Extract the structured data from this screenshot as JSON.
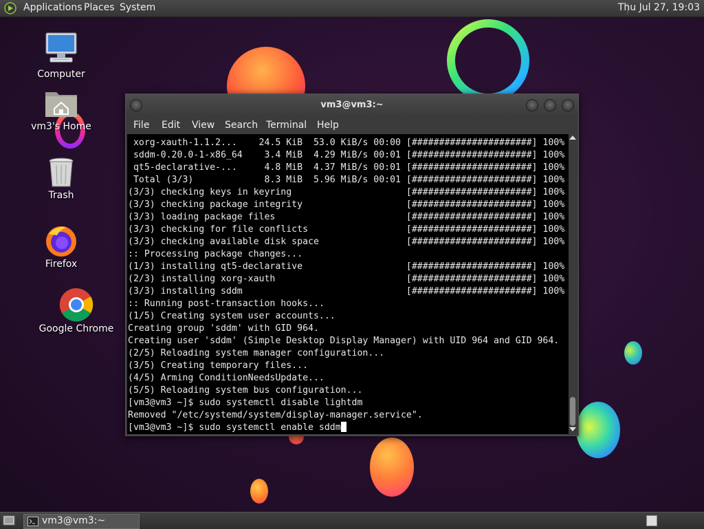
{
  "top_panel": {
    "menus": [
      "Applications",
      "Places",
      "System"
    ],
    "clock": "Thu Jul 27, 19:03"
  },
  "desktop_icons": [
    {
      "label": "Computer",
      "icon": "computer-icon"
    },
    {
      "label": "vm3's Home",
      "icon": "home-folder-icon"
    },
    {
      "label": "Trash",
      "icon": "trash-icon"
    },
    {
      "label": "Firefox",
      "icon": "firefox-icon"
    },
    {
      "label": "Google Chrome",
      "icon": "chrome-icon"
    }
  ],
  "terminal": {
    "title": "vm3@vm3:~",
    "menu": [
      "File",
      "Edit",
      "View",
      "Search",
      "Terminal",
      "Help"
    ],
    "lines": [
      " xorg-xauth-1.1.2...    24.5 KiB  53.0 KiB/s 00:00 [######################] 100%",
      " sddm-0.20.0-1-x86_64    3.4 MiB  4.29 MiB/s 00:01 [######################] 100%",
      " qt5-declarative-...     4.8 MiB  4.37 MiB/s 00:01 [######################] 100%",
      " Total (3/3)             8.3 MiB  5.96 MiB/s 00:01 [######################] 100%",
      "(3/3) checking keys in keyring                     [######################] 100%",
      "(3/3) checking package integrity                   [######################] 100%",
      "(3/3) loading package files                        [######################] 100%",
      "(3/3) checking for file conflicts                  [######################] 100%",
      "(3/3) checking available disk space                [######################] 100%",
      ":: Processing package changes...",
      "(1/3) installing qt5-declarative                   [######################] 100%",
      "(2/3) installing xorg-xauth                        [######################] 100%",
      "(3/3) installing sddm                              [######################] 100%",
      ":: Running post-transaction hooks...",
      "(1/5) Creating system user accounts...",
      "Creating group 'sddm' with GID 964.",
      "Creating user 'sddm' (Simple Desktop Display Manager) with UID 964 and GID 964.",
      "(2/5) Reloading system manager configuration...",
      "(3/5) Creating temporary files...",
      "(4/5) Arming ConditionNeedsUpdate...",
      "(5/5) Reloading system bus configuration...",
      "[vm3@vm3 ~]$ sudo systemctl disable lightdm",
      "Removed \"/etc/systemd/system/display-manager.service\".",
      "[vm3@vm3 ~]$ sudo systemctl enable sddm"
    ]
  },
  "bottom_panel": {
    "task_label": "vm3@vm3:~"
  },
  "colors": {
    "terminal_bg": "#000000",
    "terminal_fg": "#e8e8e8",
    "panel_bg": "#3c3c3c"
  }
}
